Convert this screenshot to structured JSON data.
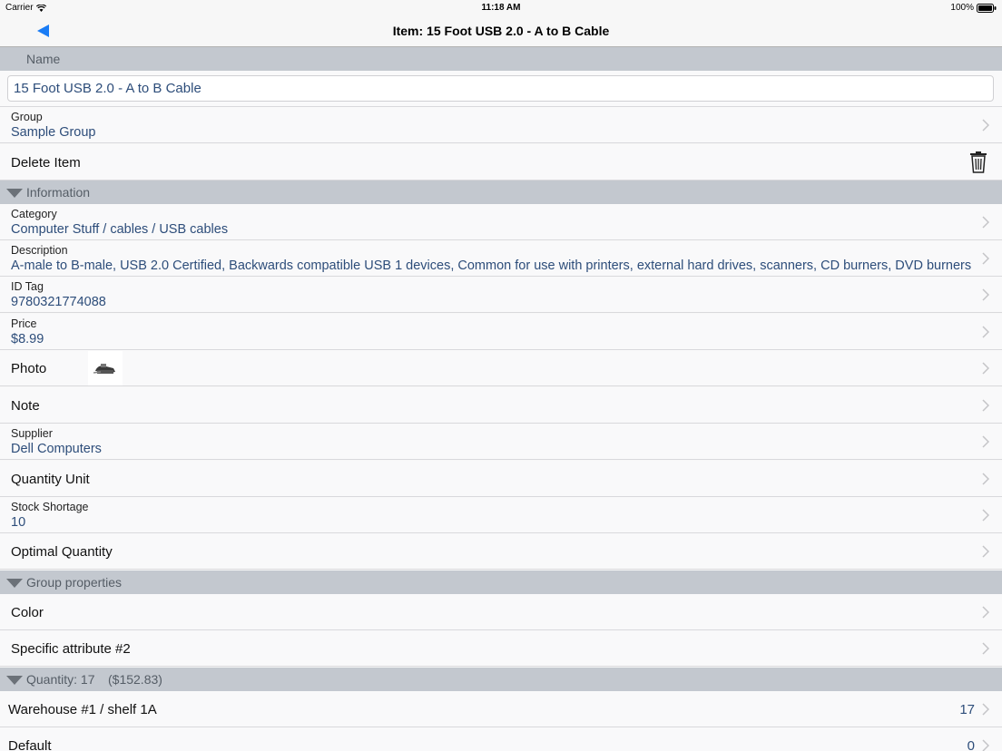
{
  "status": {
    "carrier": "Carrier",
    "time": "11:18 AM",
    "battery": "100%"
  },
  "nav": {
    "title": "Item: 15 Foot USB 2.0 - A to B Cable"
  },
  "name_section": {
    "label": "Name",
    "value": "15 Foot USB 2.0 - A to B Cable"
  },
  "group_row": {
    "label": "Group",
    "value": "Sample Group"
  },
  "delete_row": {
    "label": "Delete Item"
  },
  "information": {
    "header": "Information",
    "category": {
      "label": "Category",
      "value": "Computer Stuff / cables / USB cables"
    },
    "description": {
      "label": "Description",
      "value": "A-male to B-male, USB 2.0 Certified, Backwards compatible USB 1 devices, Common for use with printers, external hard drives, scanners, CD burners, DVD burners"
    },
    "id_tag": {
      "label": "ID Tag",
      "value": "9780321774088"
    },
    "price": {
      "label": "Price",
      "value": "$8.99"
    },
    "photo": {
      "label": "Photo"
    },
    "note": {
      "label": "Note"
    },
    "supplier": {
      "label": "Supplier",
      "value": "Dell Computers"
    },
    "quantity_unit": {
      "label": "Quantity Unit"
    },
    "stock_shortage": {
      "label": "Stock Shortage",
      "value": "10"
    },
    "optimal_quantity": {
      "label": "Optimal Quantity"
    }
  },
  "group_properties": {
    "header": "Group properties",
    "color": {
      "label": "Color"
    },
    "attr2": {
      "label": "Specific attribute #2"
    }
  },
  "quantity": {
    "header": "Quantity: 17",
    "total": "($152.83)",
    "locations": [
      {
        "label": "Warehouse #1 / shelf 1A",
        "value": "17"
      },
      {
        "label": "Default",
        "value": "0"
      }
    ]
  },
  "colors": {
    "accent": "#1a7cf5",
    "value_text": "#2d4d7a",
    "header_bg": "#c3c8cf"
  }
}
